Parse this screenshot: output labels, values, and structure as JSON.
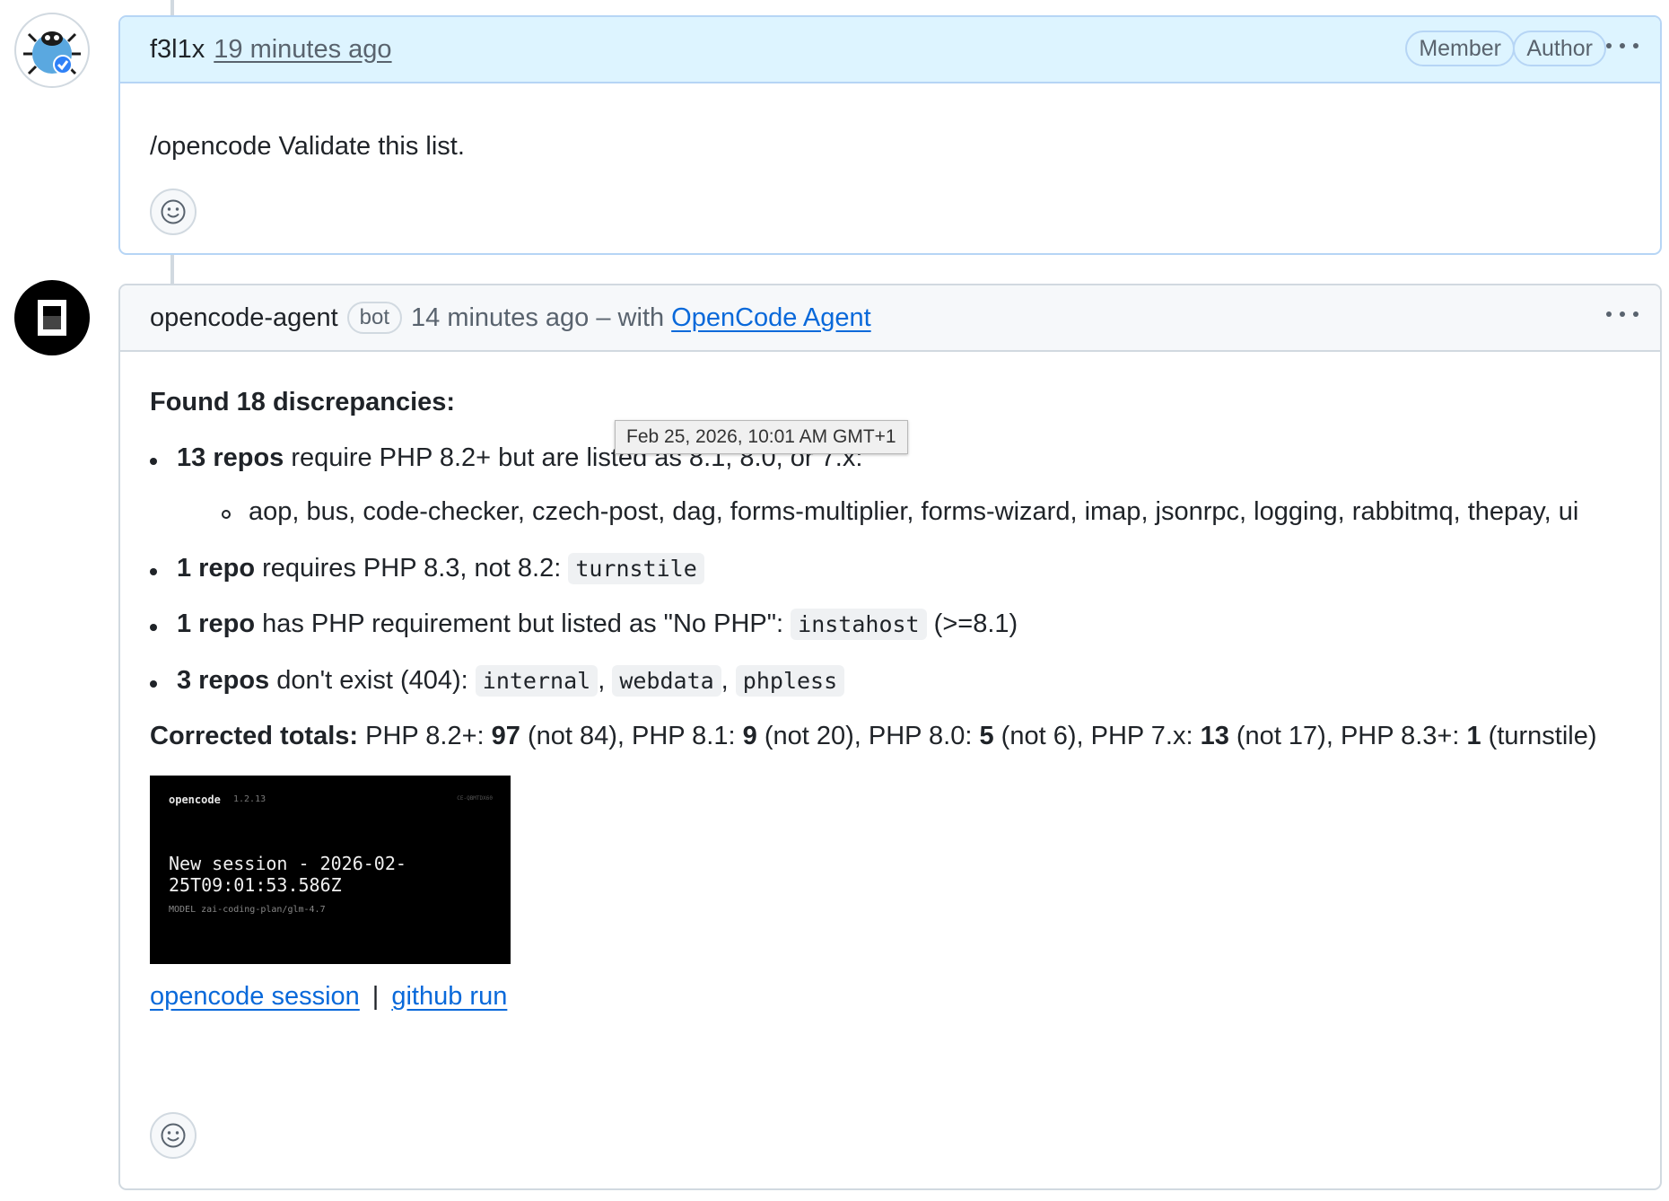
{
  "comment1": {
    "author": "f3l1x",
    "time": "19 minutes ago",
    "badges": [
      "Member",
      "Author"
    ],
    "body": "/opencode Validate this list."
  },
  "comment2": {
    "author": "opencode-agent",
    "bot_label": "bot",
    "time_prefix": "14 minutes ago – with",
    "app_link": "OpenCode Agent",
    "heading": "Found 18 discrepancies:",
    "items": [
      {
        "bold": "13 repos",
        "text": " require PHP 8.2+ but are listed as 8.1, 8.0, or 7.x:"
      },
      {
        "bold": "1 repo",
        "text": " requires PHP 8.3, not 8.2: ",
        "codes": [
          "turnstile"
        ]
      },
      {
        "bold": "1 repo",
        "text": " has PHP requirement but listed as \"No PHP\": ",
        "codes": [
          "instahost"
        ],
        "suffix": " (>=8.1)"
      },
      {
        "bold": "3 repos",
        "text": " don't exist (404): ",
        "codes": [
          "internal",
          "webdata",
          "phpless"
        ]
      }
    ],
    "sub_item": "aop, bus, code-checker, czech-post, dag, forms-multiplier, forms-wizard, imap, jsonrpc, logging, rabbitmq, thepay, ui",
    "totals": {
      "label": "Corrected totals:",
      "t1": " PHP 8.2+: ",
      "v1": "97",
      "t2": " (not 84), PHP 8.1: ",
      "v2": "9",
      "t3": " (not 20), PHP 8.0: ",
      "v3": "5",
      "t4": " (not 6), PHP 7.x: ",
      "v4": "13",
      "t5": " (not 17), PHP 8.3+: ",
      "v5": "1",
      "t6": " (turnstile)"
    },
    "screenshot": {
      "brand": "opencode",
      "version": "1.2.13",
      "corner": "CE-QBMTDX60",
      "session_line1": "New session - 2026-02-",
      "session_line2": "25T09:01:53.586Z",
      "model": "MODEL zai-coding-plan/glm-4.7"
    },
    "links": [
      "opencode session",
      "github run"
    ],
    "link_separator": "|"
  },
  "tooltip": "Feb 25, 2026, 10:01 AM GMT+1"
}
